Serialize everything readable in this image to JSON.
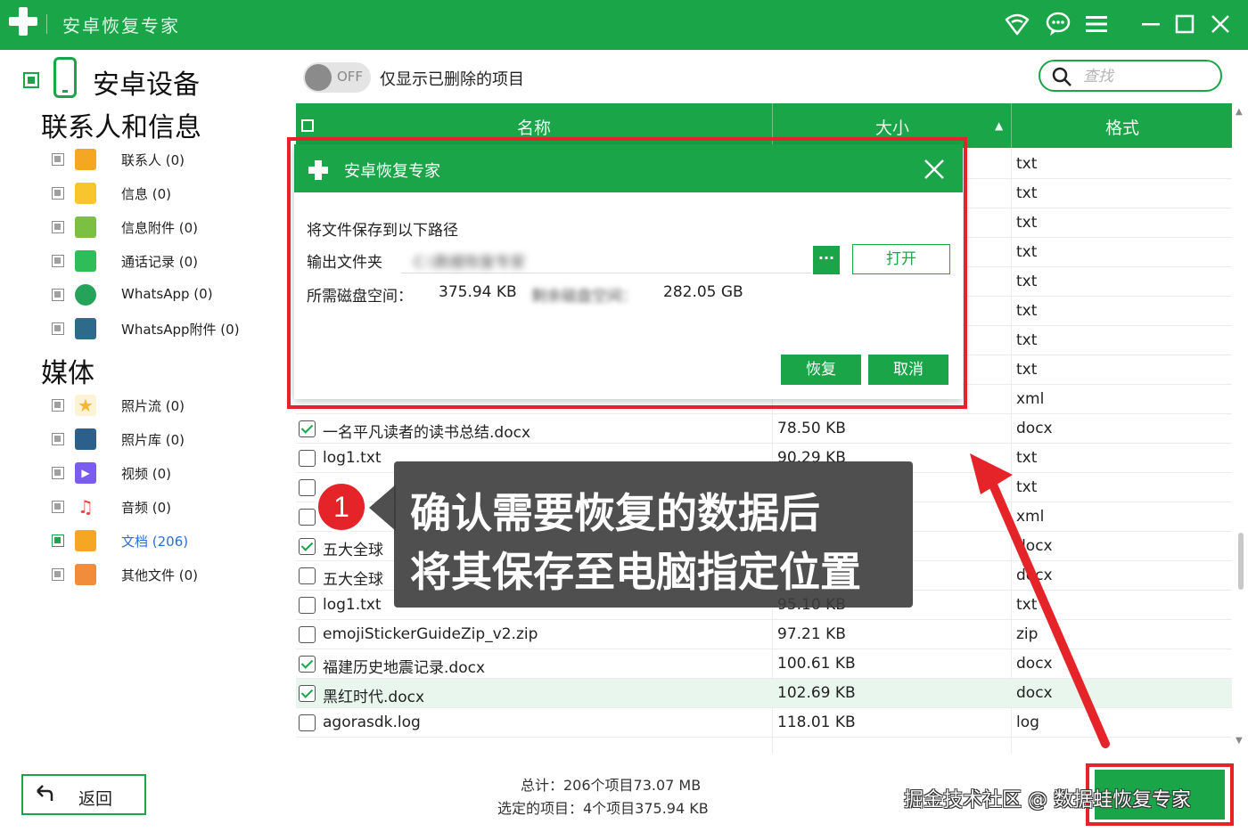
{
  "app": {
    "title": "安卓恢复专家"
  },
  "colors": {
    "brand": "#1aa548",
    "highlight_red": "#e5242a"
  },
  "sidebar": {
    "device_title": "安卓设备",
    "sections": [
      {
        "title": "联系人和信息",
        "items": [
          {
            "label": "联系人 (0)",
            "icon": "contacts-icon",
            "color": "#f5a623"
          },
          {
            "label": "信息 (0)",
            "icon": "messages-icon",
            "color": "#f7c62f"
          },
          {
            "label": "信息附件 (0)",
            "icon": "message-attachment-icon",
            "color": "#7bc043"
          },
          {
            "label": "通话记录 (0)",
            "icon": "call-log-icon",
            "color": "#2ebd59"
          },
          {
            "label": "WhatsApp (0)",
            "icon": "whatsapp-icon",
            "color": "#25a35a"
          },
          {
            "label": "WhatsApp附件 (0)",
            "icon": "whatsapp-attachment-icon",
            "color": "#2e6b8a"
          }
        ]
      },
      {
        "title": "媒体",
        "items": [
          {
            "label": "照片流 (0)",
            "icon": "photo-stream-icon",
            "color": "#f5b82e"
          },
          {
            "label": "照片库 (0)",
            "icon": "photo-library-icon",
            "color": "#2d5f8b"
          },
          {
            "label": "视频 (0)",
            "icon": "video-icon",
            "color": "#7a5cf0"
          },
          {
            "label": "音频 (0)",
            "icon": "audio-icon",
            "color": "#e8473d"
          },
          {
            "label": "文档 (206)",
            "icon": "documents-icon",
            "color": "#f5a623",
            "active": true
          },
          {
            "label": "其他文件 (0)",
            "icon": "other-files-icon",
            "color": "#f08c3a"
          }
        ]
      }
    ]
  },
  "toolbar": {
    "toggle_state": "OFF",
    "toggle_label": "仅显示已删除的项目",
    "search_placeholder": "查找"
  },
  "table": {
    "headers": {
      "name": "名称",
      "size": "大小",
      "format": "格式"
    },
    "hidden_formats": [
      "txt",
      "txt",
      "txt",
      "txt",
      "txt",
      "txt",
      "txt",
      "txt"
    ],
    "rows": [
      {
        "name": "",
        "size": "",
        "format": "xml",
        "checked": false
      },
      {
        "name": "一名平凡读者的读书总结.docx",
        "size": "78.50 KB",
        "format": "docx",
        "checked": true
      },
      {
        "name": "log1.txt",
        "size": "90.29 KB",
        "format": "txt",
        "checked": false
      },
      {
        "name": "",
        "size": "",
        "format": "txt",
        "checked": false
      },
      {
        "name": "",
        "size": "",
        "format": "xml",
        "checked": false
      },
      {
        "name": "五大全球",
        "size": "",
        "format": "docx",
        "checked": true
      },
      {
        "name": "五大全球",
        "size": "",
        "format": "docx",
        "checked": false
      },
      {
        "name": "log1.txt",
        "size": "95.10 KB",
        "format": "txt",
        "checked": false
      },
      {
        "name": "emojiStickerGuideZip_v2.zip",
        "size": "97.21 KB",
        "format": "zip",
        "checked": false
      },
      {
        "name": "福建历史地震记录.docx",
        "size": "100.61 KB",
        "format": "docx",
        "checked": true
      },
      {
        "name": "黑红时代.docx",
        "size": "102.69 KB",
        "format": "docx",
        "checked": true,
        "highlight": true
      },
      {
        "name": "agorasdk.log",
        "size": "118.01 KB",
        "format": "log",
        "checked": false
      }
    ]
  },
  "dialog": {
    "title": "安卓恢复专家",
    "save_to_text": "将文件保存到以下路径",
    "output_label": "输出文件夹",
    "output_path": "C:\\数据恢复专家",
    "disk_required_label": "所需磁盘空间：",
    "disk_required_value": "375.94 KB",
    "disk_free_label": "剩余磁盘空间：",
    "disk_free_value": "282.05 GB",
    "browse_label": "···",
    "open_label": "打开",
    "recover_label": "恢复",
    "cancel_label": "取消"
  },
  "callout": {
    "badge": "1",
    "line1": "确认需要恢复的数据后",
    "line2": "将其保存至电脑指定位置"
  },
  "footer": {
    "back_label": "返回",
    "total_text": "总计：206个项目73.07 MB",
    "selected_text": "选定的项目：4个项目375.94 KB",
    "watermark": "掘金技术社区 @ 数据蛙恢复专家"
  }
}
